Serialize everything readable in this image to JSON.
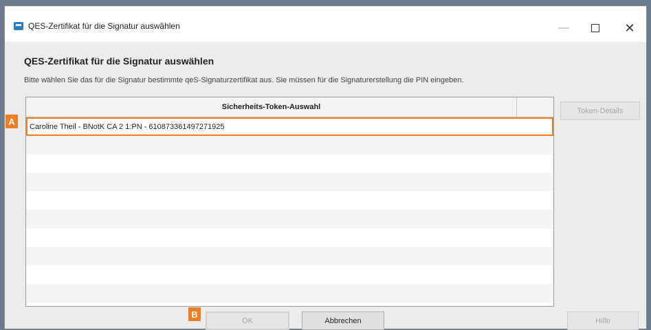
{
  "window": {
    "title": "QES-Zertifikat für die Signatur auswählen",
    "controls": {
      "minimize": "—",
      "close": "✕"
    }
  },
  "dialog": {
    "heading": "QES-Zertifikat für die Signatur auswählen",
    "description": "Bitte wählen Sie das für die Signatur bestimmte qeS-Signaturzertifikat aus. Sie müssen für die Signaturerstellung die PIN eingeben."
  },
  "table": {
    "column_header": "Sicherheits-Token-Auswahl",
    "rows": [
      "Caroline Theil - BNotK CA 2 1:PN - 610873361497271925",
      "",
      "",
      "",
      "",
      "",
      "",
      "",
      "",
      "",
      ""
    ],
    "selected_index": 0
  },
  "buttons": {
    "token_details": "Token-Details",
    "ok": "OK",
    "cancel": "Abbrechen",
    "help": "Hilfe"
  },
  "markers": {
    "a": "A",
    "b": "B"
  },
  "colors": {
    "highlight": "#f07d22",
    "icon": "#2a7fc0"
  }
}
